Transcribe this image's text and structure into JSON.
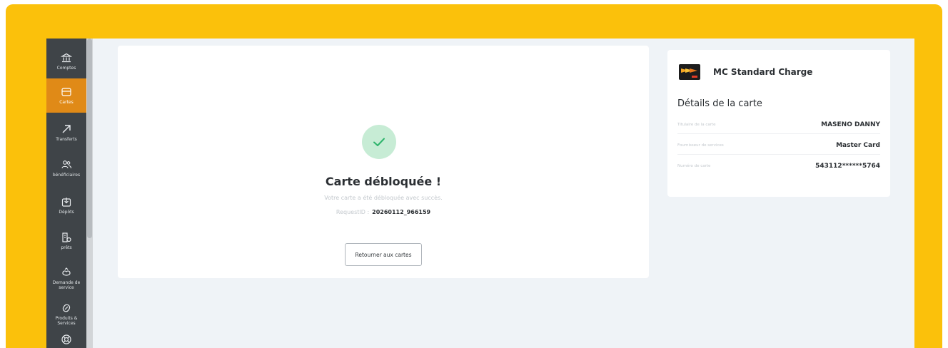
{
  "sidebar": {
    "items": [
      {
        "label": "Comptes",
        "icon": "bank-icon",
        "active": false
      },
      {
        "label": "Cartes",
        "icon": "card-icon",
        "active": true
      },
      {
        "label": "Transferts",
        "icon": "arrow-up-right-icon",
        "active": false
      },
      {
        "label": "bénéficiaires",
        "icon": "users-icon",
        "active": false
      },
      {
        "label": "Dépôts",
        "icon": "deposit-icon",
        "active": false
      },
      {
        "label": "prêts",
        "icon": "loan-icon",
        "active": false
      },
      {
        "label": "Demande de service",
        "icon": "service-request-icon",
        "active": false
      },
      {
        "label": "Produits & Services",
        "icon": "products-icon",
        "active": false
      },
      {
        "label": "",
        "icon": "help-icon",
        "active": false
      }
    ]
  },
  "main": {
    "title": "Carte débloquée !",
    "subtitle": "Votre carte a été débloquée avec succès.",
    "request_label": "RequestID :",
    "request_id": "20260112_966159",
    "return_button": "Retourner aux cartes"
  },
  "details": {
    "card_name": "MC Standard Charge",
    "title": "Détails de la carte",
    "rows": [
      {
        "label": "Titulaire de la carte",
        "value": "MASENO DANNY"
      },
      {
        "label": "Fournisseur de services",
        "value": "Master Card"
      },
      {
        "label": "Numéro de carte",
        "value": "543112******5764"
      }
    ]
  },
  "colors": {
    "frame": "#fbc10b",
    "sidebar": "#3f4448",
    "active_nav": "#e08a17",
    "success_bg": "#c7ecd5",
    "success_check": "#2db46b"
  }
}
